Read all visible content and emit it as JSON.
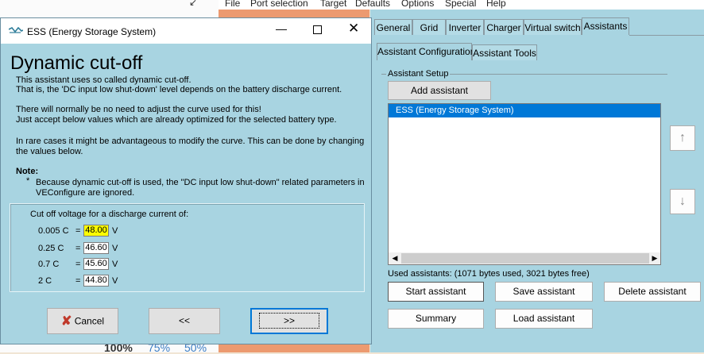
{
  "background": {
    "menu": [
      "File",
      "Port selection",
      "Target",
      "Defaults",
      "Options",
      "Special",
      "Help"
    ],
    "zoom": [
      "100%",
      "75%",
      "50%"
    ],
    "tabs": [
      "General",
      "Grid",
      "Inverter",
      "Charger",
      "Virtual switch",
      "Assistants"
    ],
    "subtabs": [
      "Assistant Configuration",
      "Assistant Tools"
    ],
    "group_label": "Assistant Setup",
    "add_label": "Add assistant",
    "assistants": [
      "ESS (Energy Storage System)"
    ],
    "used_text": "Used assistants: (1071 bytes used, 3021 bytes free)",
    "buttons": {
      "start": "Start assistant",
      "save": "Save assistant",
      "delete": "Delete assistant",
      "summary": "Summary",
      "load": "Load assistant"
    }
  },
  "dialog": {
    "title": "ESS (Energy Storage System)",
    "heading": "Dynamic cut-off",
    "para1a": "This assistant uses so called dynamic cut-off.",
    "para1b": "That is, the  'DC input low shut-down' level depends on the battery discharge current.",
    "para2a": "There will normally be no need to adjust the curve used for this!",
    "para2b": "Just accept below values which are already optimized for the selected battery type.",
    "para3a": "In rare cases it might be advantageous to modify the curve. This can be done by changing",
    "para3b": "the values below.",
    "note_label": "Note:",
    "note_bullet": "*",
    "note_a": "Because dynamic cut-off is used, the \"DC input low shut-down\" related parameters in",
    "note_b": "VEConfigure are ignored.",
    "group_label": "Cut off voltage for a discharge current of:",
    "rows": [
      {
        "c": "0.005 C",
        "eq": "=",
        "value": "48.00",
        "unit": "V"
      },
      {
        "c": "0.25 C",
        "eq": "=",
        "value": "46.60",
        "unit": "V"
      },
      {
        "c": "0.7 C",
        "eq": "=",
        "value": "45.60",
        "unit": "V"
      },
      {
        "c": "2 C",
        "eq": "=",
        "value": "44.80",
        "unit": "V"
      }
    ],
    "buttons": {
      "cancel": "Cancel",
      "back": "<<",
      "next": ">>"
    },
    "colors": {
      "highlight": "#ffff00",
      "cancel_x": "#c0392b"
    }
  }
}
